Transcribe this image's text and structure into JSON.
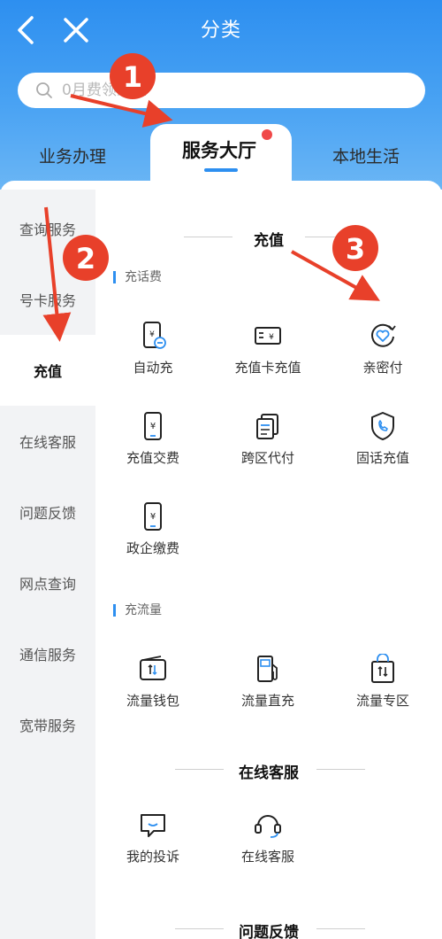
{
  "nav": {
    "title": "分类"
  },
  "search": {
    "placeholder": "0月费领流量"
  },
  "tabs": {
    "left": "业务办理",
    "active": "服务大厅",
    "right": "本地生活"
  },
  "sidebar": {
    "items": [
      "查询服务",
      "号卡服务",
      "充值",
      "在线客服",
      "问题反馈",
      "网点查询",
      "通信服务",
      "宽带服务"
    ],
    "active_index": 2
  },
  "sections": {
    "recharge": {
      "title": "充值",
      "phone_fee": {
        "title": "充话费",
        "items": [
          {
            "label": "自动充",
            "icon": "phone-auto-recharge-icon"
          },
          {
            "label": "充值卡充值",
            "icon": "recharge-card-icon"
          },
          {
            "label": "亲密付",
            "icon": "heart-refresh-icon"
          },
          {
            "label": "充值交费",
            "icon": "phone-yuan-icon"
          },
          {
            "label": "跨区代付",
            "icon": "documents-icon"
          },
          {
            "label": "固话充值",
            "icon": "shield-phone-icon"
          },
          {
            "label": "政企缴费",
            "icon": "phone-yuan-icon"
          }
        ]
      },
      "data_traffic": {
        "title": "充流量",
        "items": [
          {
            "label": "流量钱包",
            "icon": "data-wallet-icon"
          },
          {
            "label": "流量直充",
            "icon": "fuel-pump-icon"
          },
          {
            "label": "流量专区",
            "icon": "shopping-bag-icon"
          }
        ]
      }
    },
    "online_service": {
      "title": "在线客服",
      "items": [
        {
          "label": "我的投诉",
          "icon": "chat-bubble-icon"
        },
        {
          "label": "在线客服",
          "icon": "headset-icon"
        }
      ]
    },
    "feedback": {
      "title": "问题反馈"
    }
  },
  "annotations": {
    "one": "1",
    "two": "2",
    "three": "3"
  },
  "colors": {
    "brand": "#2d8ff0",
    "badge": "#f04848",
    "arrow": "#e8402a"
  }
}
